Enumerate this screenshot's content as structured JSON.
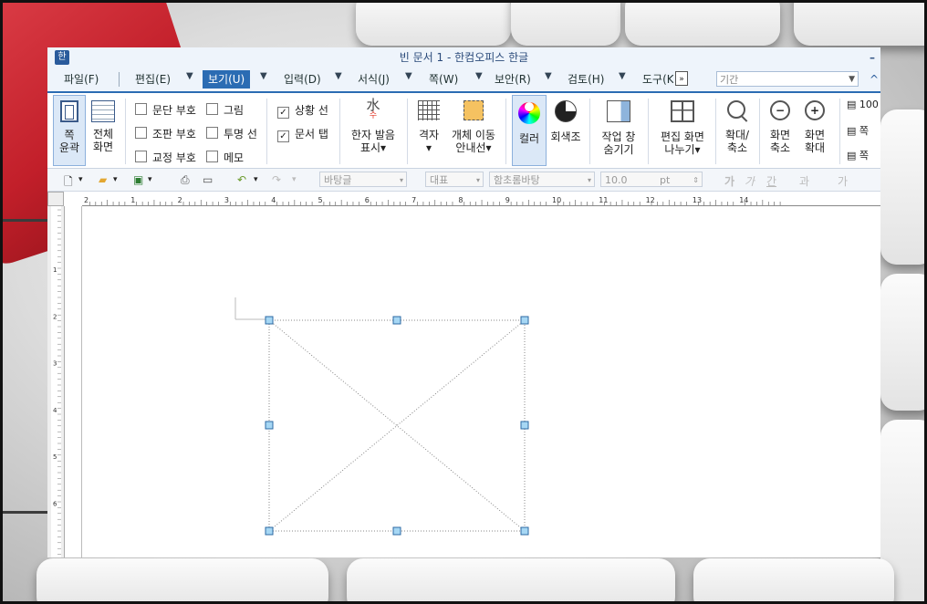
{
  "window": {
    "title": "빈 문서 1 - 한컴오피스 한글",
    "logo": "한",
    "minimize": "–"
  },
  "menu": {
    "items": [
      {
        "label": "파일(F)"
      },
      {
        "label": "편집(E)"
      },
      {
        "label": "보기(U)"
      },
      {
        "label": "입력(D)"
      },
      {
        "label": "서식(J)"
      },
      {
        "label": "쪽(W)"
      },
      {
        "label": "보안(R)"
      },
      {
        "label": "검토(H)"
      },
      {
        "label": "도구(K)"
      }
    ],
    "search_placeholder": "기간",
    "overflow": "»",
    "collapse": "^"
  },
  "ribbon": {
    "page_outline": "쪽\n윤곽",
    "full_screen": "전체\n화면",
    "checks": [
      {
        "label": "문단 부호",
        "checked": false
      },
      {
        "label": "그림",
        "checked": false
      },
      {
        "label": "조판 부호",
        "checked": false
      },
      {
        "label": "투명 선",
        "checked": false
      },
      {
        "label": "교정 부호",
        "checked": false
      },
      {
        "label": "메모",
        "checked": false
      },
      {
        "label": "상황 선",
        "checked": true
      },
      {
        "label": "문서 탭",
        "checked": true
      }
    ],
    "hanja": "한자 발음\n표시▾",
    "hanja_glyph": "水",
    "hanja_sub": "수",
    "grid": "격자\n▾",
    "obj_move": "개체 이동\n안내선▾",
    "color": "컬러",
    "gray": "회색조",
    "task_window": "작업 창\n숨기기",
    "split_view": "편집 화면\n나누기▾",
    "zoom": "확대/\n축소",
    "zoom_out": "화면\n축소",
    "zoom_in": "화면\n확대",
    "right_items": [
      "100",
      "쪽",
      "쪽"
    ]
  },
  "toolbar": {
    "style": "바탕글",
    "representative": "대표",
    "font": "함초롬바탕",
    "size": "10.0",
    "unit": "pt",
    "format_glyphs": [
      "가",
      "가",
      "간",
      "과",
      "가"
    ]
  },
  "ruler": {
    "h_marks": [
      "2",
      "1",
      "2",
      "3",
      "4",
      "5",
      "6",
      "7",
      "8",
      "9",
      "10",
      "11",
      "12",
      "13",
      "14"
    ],
    "v_marks": [
      "1",
      "2",
      "3",
      "4",
      "5",
      "6"
    ]
  },
  "colors": {
    "accent": "#2b6cb3",
    "menubar": "#eef4fb",
    "handle": "#9fd0f0"
  }
}
